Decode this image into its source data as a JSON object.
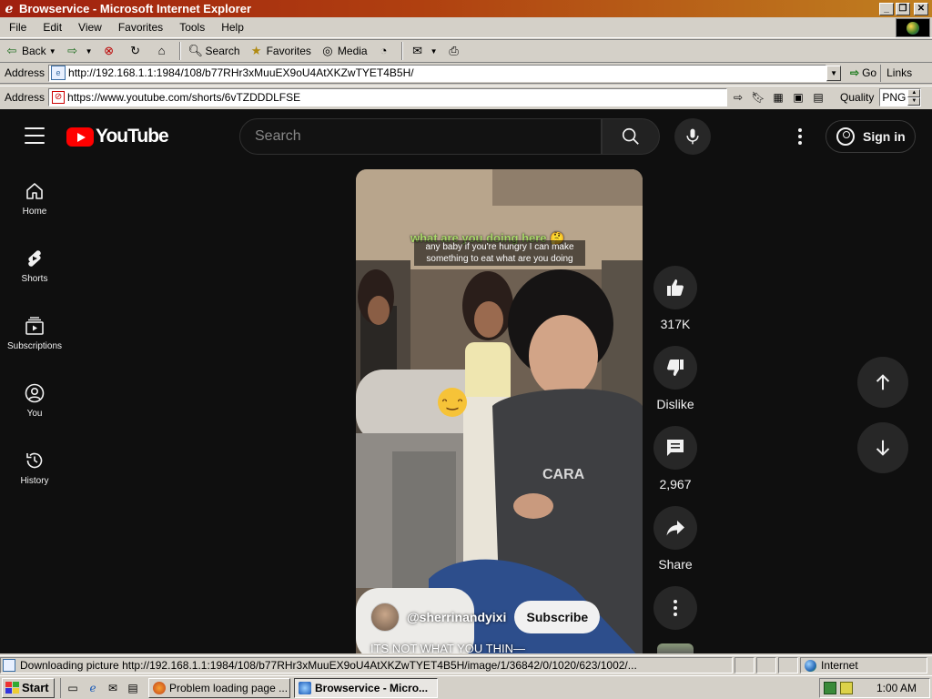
{
  "window": {
    "title": "Browservice - Microsoft Internet Explorer",
    "minimize_label": "_",
    "restore_label": "❐",
    "close_label": "✕"
  },
  "menu": [
    "File",
    "Edit",
    "View",
    "Favorites",
    "Tools",
    "Help"
  ],
  "toolbar": {
    "back": "Back",
    "search": "Search",
    "favorites": "Favorites",
    "media": "Media"
  },
  "address": {
    "label": "Address",
    "url": "http://192.168.1.1:1984/108/b77RHr3xMuuEX9oU4AtXKZwTYET4B5H/",
    "go": "Go",
    "links": "Links"
  },
  "inner_address": {
    "label": "Address",
    "url": "https://www.youtube.com/shorts/6vTZDDDLFSE",
    "quality_label": "Quality",
    "quality_value": "PNG"
  },
  "youtube": {
    "logo_text": "YouTube",
    "search_placeholder": "Search",
    "sign_in": "Sign in",
    "sidebar": [
      {
        "label": "Home",
        "icon": "home-icon"
      },
      {
        "label": "Shorts",
        "icon": "shorts-icon"
      },
      {
        "label": "Subscriptions",
        "icon": "subscriptions-icon"
      },
      {
        "label": "You",
        "icon": "you-icon"
      },
      {
        "label": "History",
        "icon": "history-icon"
      }
    ],
    "video": {
      "caption_green": "what are you doing here 🤔",
      "caption_text": "any baby if you're hungry I can make something to eat what are you doing",
      "channel": "@sherrinandyixi",
      "subscribe": "Subscribe",
      "title": "ITS NOT WHAT YOU THIN—"
    },
    "actions": {
      "likes": "317K",
      "dislike": "Dislike",
      "comments": "2,967",
      "share": "Share"
    }
  },
  "status": {
    "text": "Downloading picture http://192.168.1.1:1984/108/b77RHr3xMuuEX9oU4AtXKZwTYET4B5H/image/1/36842/0/1020/623/1002/...",
    "zone": "Internet"
  },
  "taskbar": {
    "start": "Start",
    "tasks": [
      "Problem loading page ...",
      "Browservice - Micro..."
    ],
    "clock": "1:00 AM"
  },
  "colors": {
    "yt_background": "#0f0f0f",
    "yt_red": "#ff0000",
    "chrome_gray": "#d4d0c8"
  }
}
